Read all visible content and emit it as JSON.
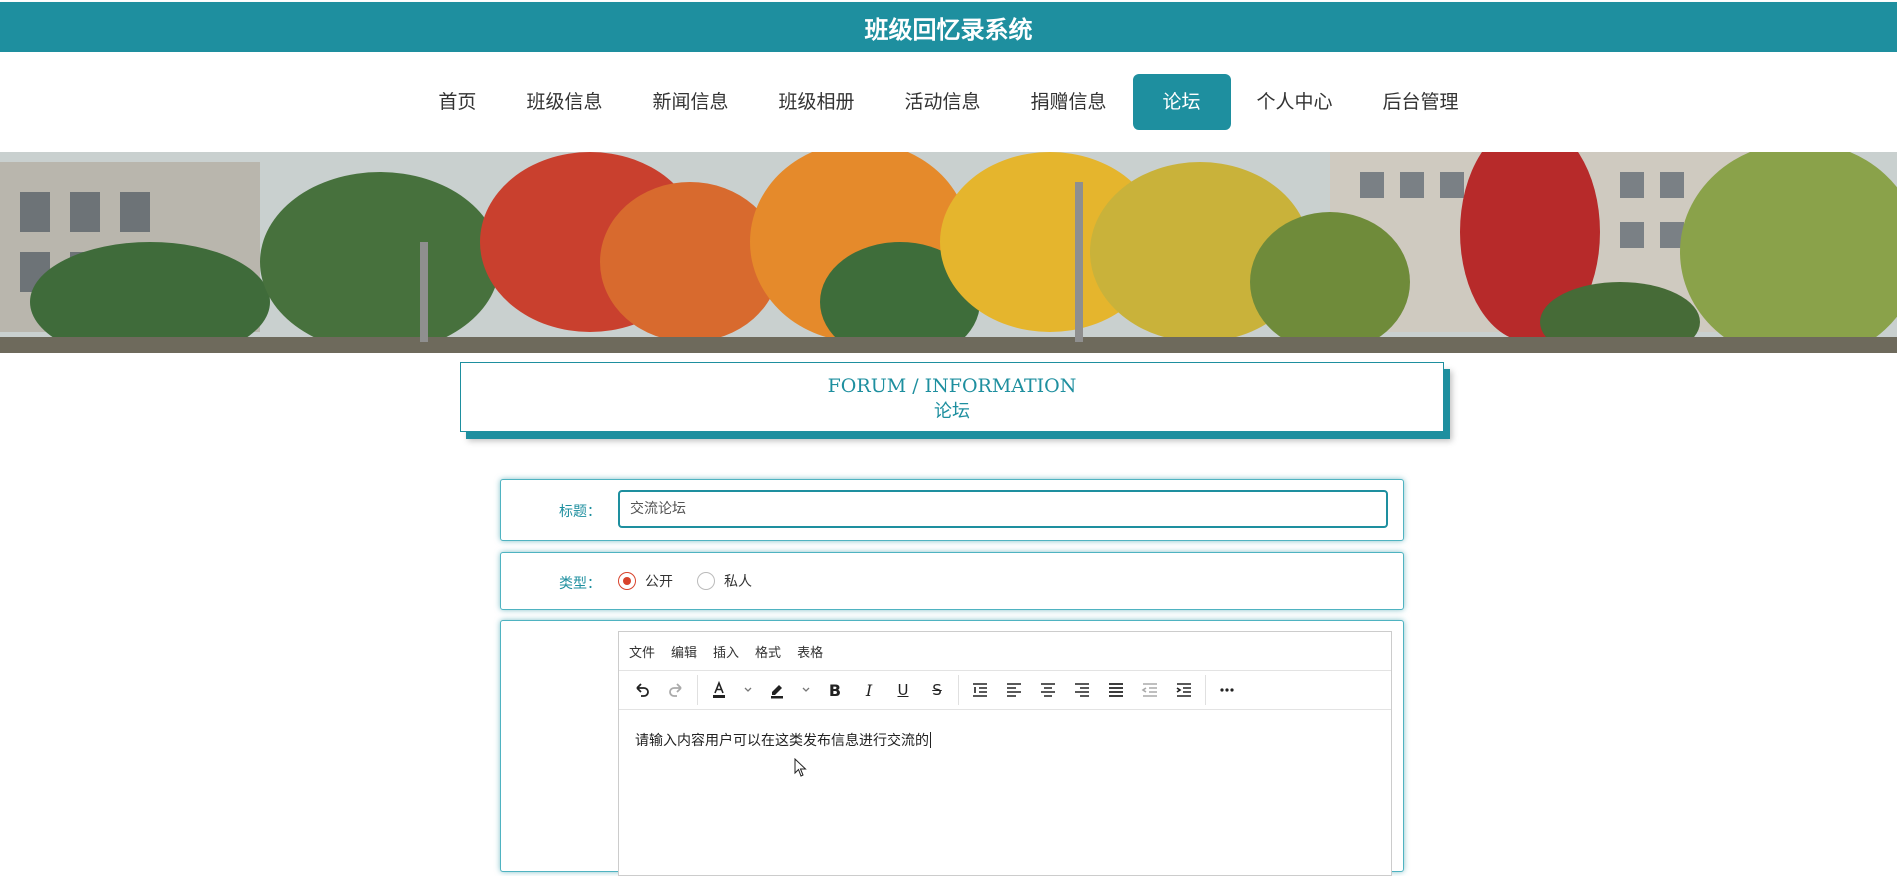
{
  "header": {
    "title": "班级回忆录系统"
  },
  "nav": {
    "items": [
      {
        "label": "首页"
      },
      {
        "label": "班级信息"
      },
      {
        "label": "新闻信息"
      },
      {
        "label": "班级相册"
      },
      {
        "label": "活动信息"
      },
      {
        "label": "捐赠信息"
      },
      {
        "label": "论坛",
        "active": true
      },
      {
        "label": "个人中心"
      },
      {
        "label": "后台管理"
      }
    ],
    "active_color": "#1e8f9f"
  },
  "banner": {
    "icon": "autumn-campus-photo"
  },
  "section": {
    "title_en": "FORUM / INFORMATION",
    "title_zh": "论坛"
  },
  "form": {
    "title_label": "标题：",
    "title_value": "交流论坛",
    "type_label": "类型：",
    "type_options": [
      {
        "label": "公开",
        "checked": true
      },
      {
        "label": "私人",
        "checked": false
      }
    ]
  },
  "editor": {
    "menu": [
      "文件",
      "编辑",
      "插入",
      "格式",
      "表格"
    ],
    "toolbar_icons": [
      "undo-icon",
      "redo-icon",
      "text-color-icon",
      "highlight-color-icon",
      "bold-icon",
      "italic-icon",
      "underline-icon",
      "strikethrough-icon",
      "line-height-icon",
      "align-left-icon",
      "align-center-icon",
      "align-right-icon",
      "align-justify-icon",
      "outdent-icon",
      "indent-icon",
      "more-icon"
    ],
    "content": "请输入内容用户可以在这类发布信息进行交流的"
  },
  "colors": {
    "primary": "#1e8f9f",
    "radio_checked": "#d8432c"
  }
}
